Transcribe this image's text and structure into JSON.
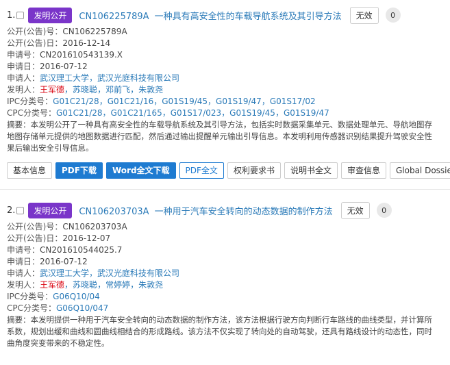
{
  "records": [
    {
      "index": "1.",
      "badge": "发明公开",
      "pub_no": "CN106225789A",
      "title": "一种具有高安全性的车载导航系统及其引导方法",
      "status": "无效",
      "count": "0",
      "fields": {
        "pub_no_label": "公开(公告)号：",
        "pub_no_value": "CN106225789A",
        "pub_date_label": "公开(公告)日：",
        "pub_date_value": "2016-12-14",
        "app_no_label": "申请号：",
        "app_no_value": "CN201610543139.X",
        "app_date_label": "申请日：",
        "app_date_value": "2016-07-12",
        "applicant_label": "申请人：",
        "applicants": [
          "武汉理工大学",
          "武汉光庭科技有限公司"
        ],
        "inventor_label": "发明人：",
        "inventors": [
          "王军德",
          "苏晓聪",
          "邓前飞",
          "朱敦尧"
        ],
        "ipc_label": "IPC分类号：",
        "ipc": [
          "G01C21/28",
          "G01C21/16",
          "G01S19/45",
          "G01S19/47",
          "G01S17/02"
        ],
        "cpc_label": "CPC分类号：",
        "cpc": [
          "G01C21/28",
          "G01C21/165",
          "G01S17/023",
          "G01S19/45",
          "G01S19/47"
        ]
      },
      "abstract_label": "摘要：",
      "abstract_lines": [
        "本发明公开了一种具有高安全性的车载导航系统及其引导方法，包括实时数据采集单元、数据处理单元、导航地图存",
        "地图存储单元提供的地图数据进行匹配，然后通过输出提醒单元输出引导信息。本发明利用传感器识别结果提升驾驶安全性",
        "果后输出安全引导信息。"
      ],
      "buttons": [
        "基本信息",
        "PDF下载",
        "Word全文下载",
        "PDF全文",
        "权利要求书",
        "说明书全文",
        "审查信息",
        "Global Dossier"
      ]
    },
    {
      "index": "2.",
      "badge": "发明公开",
      "pub_no": "CN106203703A",
      "title": "一种用于汽车安全转向的动态数据的制作方法",
      "status": "无效",
      "count": "0",
      "fields": {
        "pub_no_label": "公开(公告)号：",
        "pub_no_value": "CN106203703A",
        "pub_date_label": "公开(公告)日：",
        "pub_date_value": "2016-12-07",
        "app_no_label": "申请号：",
        "app_no_value": "CN201610544025.7",
        "app_date_label": "申请日：",
        "app_date_value": "2016-07-12",
        "applicant_label": "申请人：",
        "applicants": [
          "武汉理工大学",
          "武汉光庭科技有限公司"
        ],
        "inventor_label": "发明人：",
        "inventors": [
          "王军德",
          "苏晓聪",
          "常婷婷",
          "朱敦尧"
        ],
        "ipc_label": "IPC分类号：",
        "ipc": [
          "G06Q10/04"
        ],
        "cpc_label": "CPC分类号：",
        "cpc": [
          "G06Q10/047"
        ]
      },
      "abstract_label": "摘要：",
      "abstract_lines": [
        "本发明提供一种用于汽车安全转向的动态数据的制作方法，该方法根据行驶方向判断行车路线的曲线类型，并计算所",
        "系数，规划出缓和曲线和圆曲线相结合的形成路线。该方法不仅实现了转向处的自动驾驶，还具有路线设计的动态性，同时",
        "曲角度突变带来的不稳定性。"
      ]
    }
  ]
}
